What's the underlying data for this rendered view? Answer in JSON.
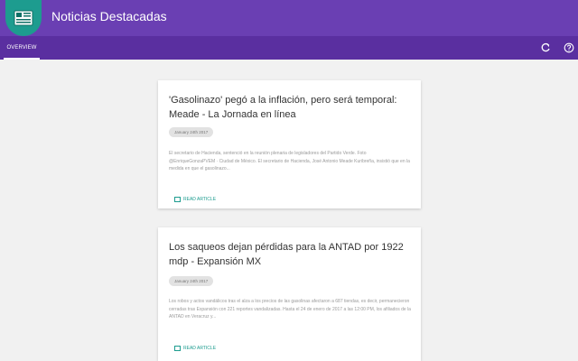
{
  "header": {
    "title": "Noticias Destacadas",
    "logo_icon": "newspaper-icon",
    "refresh_icon": "refresh-icon",
    "help_icon": "help-icon"
  },
  "tabs": [
    {
      "label": "OVERVIEW",
      "active": true
    }
  ],
  "colors": {
    "header": "#6a3fb3",
    "tabbar": "#5a2fa0",
    "accent": "#1d9c8f",
    "background": "#f1f1f1"
  },
  "articles": [
    {
      "title": "'Gasolinazo' pegó a la inflación, pero será temporal: Meade - La Jornada en línea",
      "date": "January 24th 2017",
      "excerpt": "El secretario de Hacienda, sentenció en la reunión plenaria de legisladores del Partido Verde. Foto @EnriqueGonzaPVEM · Ciudad de México. El secretario de Hacienda, José Antonio Meade Kuribreña, insistió que en la medida en que el gasolinazo...",
      "link_label": "READ ARTICLE"
    },
    {
      "title": "Los saqueos dejan pérdidas para la ANTAD por 1922 mdp - Expansión MX",
      "date": "January 24th 2017",
      "excerpt": "Los robos y actos vandálicos tras el alza a los precios de las gasolinas afectaron a 687 tiendas, es decir, permanecieron cerradas tras Expansión con 221 reportes vandalizadas. Hasta el 24 de enero de 2017 a las 12:00 PM, los afiliados de la ANTAD en Veracruz y...",
      "link_label": "READ ARTICLE"
    }
  ]
}
